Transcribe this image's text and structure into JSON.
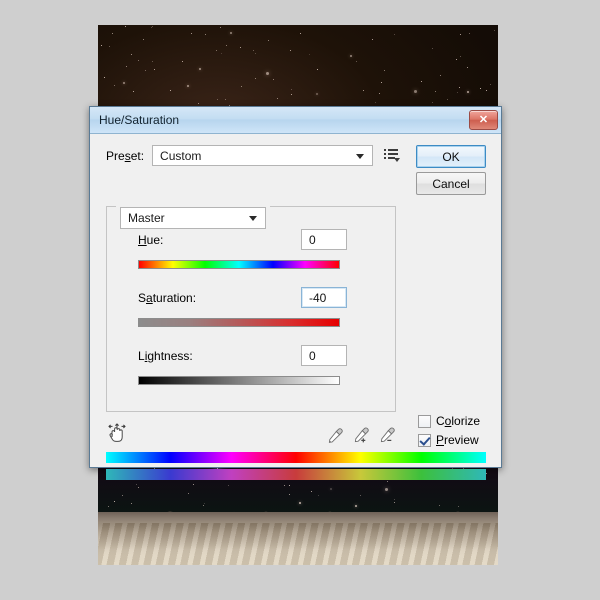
{
  "app": {
    "photo_alt": "night-sky-over-badlands-photo"
  },
  "dialog": {
    "title": "Hue/Saturation",
    "close_label": "✕",
    "preset": {
      "label": "Preset:",
      "label_prefix": "Pre",
      "label_accel": "s",
      "label_suffix": "et:",
      "value": "Custom",
      "menu_icon": "preset-options-icon"
    },
    "buttons": {
      "ok": "OK",
      "cancel": "Cancel"
    },
    "channel": {
      "value": "Master"
    },
    "sliders": [
      {
        "id": "hue",
        "label": "Hue:",
        "label_prefix": "",
        "label_accel": "H",
        "label_suffix": "ue:",
        "value": "0",
        "thumb_percent": 50,
        "gradient": "linear-gradient(90deg,#ff0000 0%,#ffff00 17%,#00ff00 33%,#00ffff 50%,#0000ff 67%,#ff00ff 83%,#ff0000 100%)",
        "focused": false
      },
      {
        "id": "saturation",
        "label": "Saturation:",
        "label_prefix": "S",
        "label_accel": "a",
        "label_suffix": "turation:",
        "value": "-40",
        "thumb_percent": 30,
        "gradient": "linear-gradient(90deg,#8c8c8c 0%,#9a8080 25%,#b55a5a 50%,#d83030 75%,#e60000 100%)",
        "focused": true
      },
      {
        "id": "lightness",
        "label": "Lightness:",
        "label_prefix": "L",
        "label_accel": "i",
        "label_suffix": "ghtness:",
        "value": "0",
        "thumb_percent": 50,
        "gradient": "linear-gradient(90deg,#000000 0%,#808080 50%,#ffffff 100%)",
        "focused": false
      }
    ],
    "tools": {
      "hand": "on-image-adjustment-hand-icon",
      "eyedropper": "eyedropper-icon",
      "eyedropper_add": "eyedropper-plus-icon",
      "eyedropper_subtract": "eyedropper-minus-icon"
    },
    "checkboxes": [
      {
        "id": "colorize",
        "label": "Colorize",
        "label_prefix": "C",
        "label_accel": "o",
        "label_suffix": "lorize",
        "checked": false
      },
      {
        "id": "preview",
        "label": "Preview",
        "label_prefix": "",
        "label_accel": "P",
        "label_suffix": "review",
        "checked": true
      }
    ],
    "spectrum": {
      "top_gradient": "linear-gradient(90deg,#00ffff 0%,#0000ff 17%,#ff00ff 33%,#ff0000 50%,#ffff00 67%,#00ff00 83%,#00ffff 100%)",
      "bottom_gradient": "linear-gradient(90deg,#2fb8b8 0%,#3a3ad0 17%,#c040c0 33%,#c83c3c 50%,#c8c83a 67%,#3cc03c 83%,#2fb8b8 100%)"
    }
  },
  "colors": {
    "titlebar": "#c3ddf2",
    "dialog_bg": "#f0f0f0",
    "accent": "#3d8bc4",
    "close_red": "#cd5e4f",
    "thumb_green": "#5b8055"
  }
}
